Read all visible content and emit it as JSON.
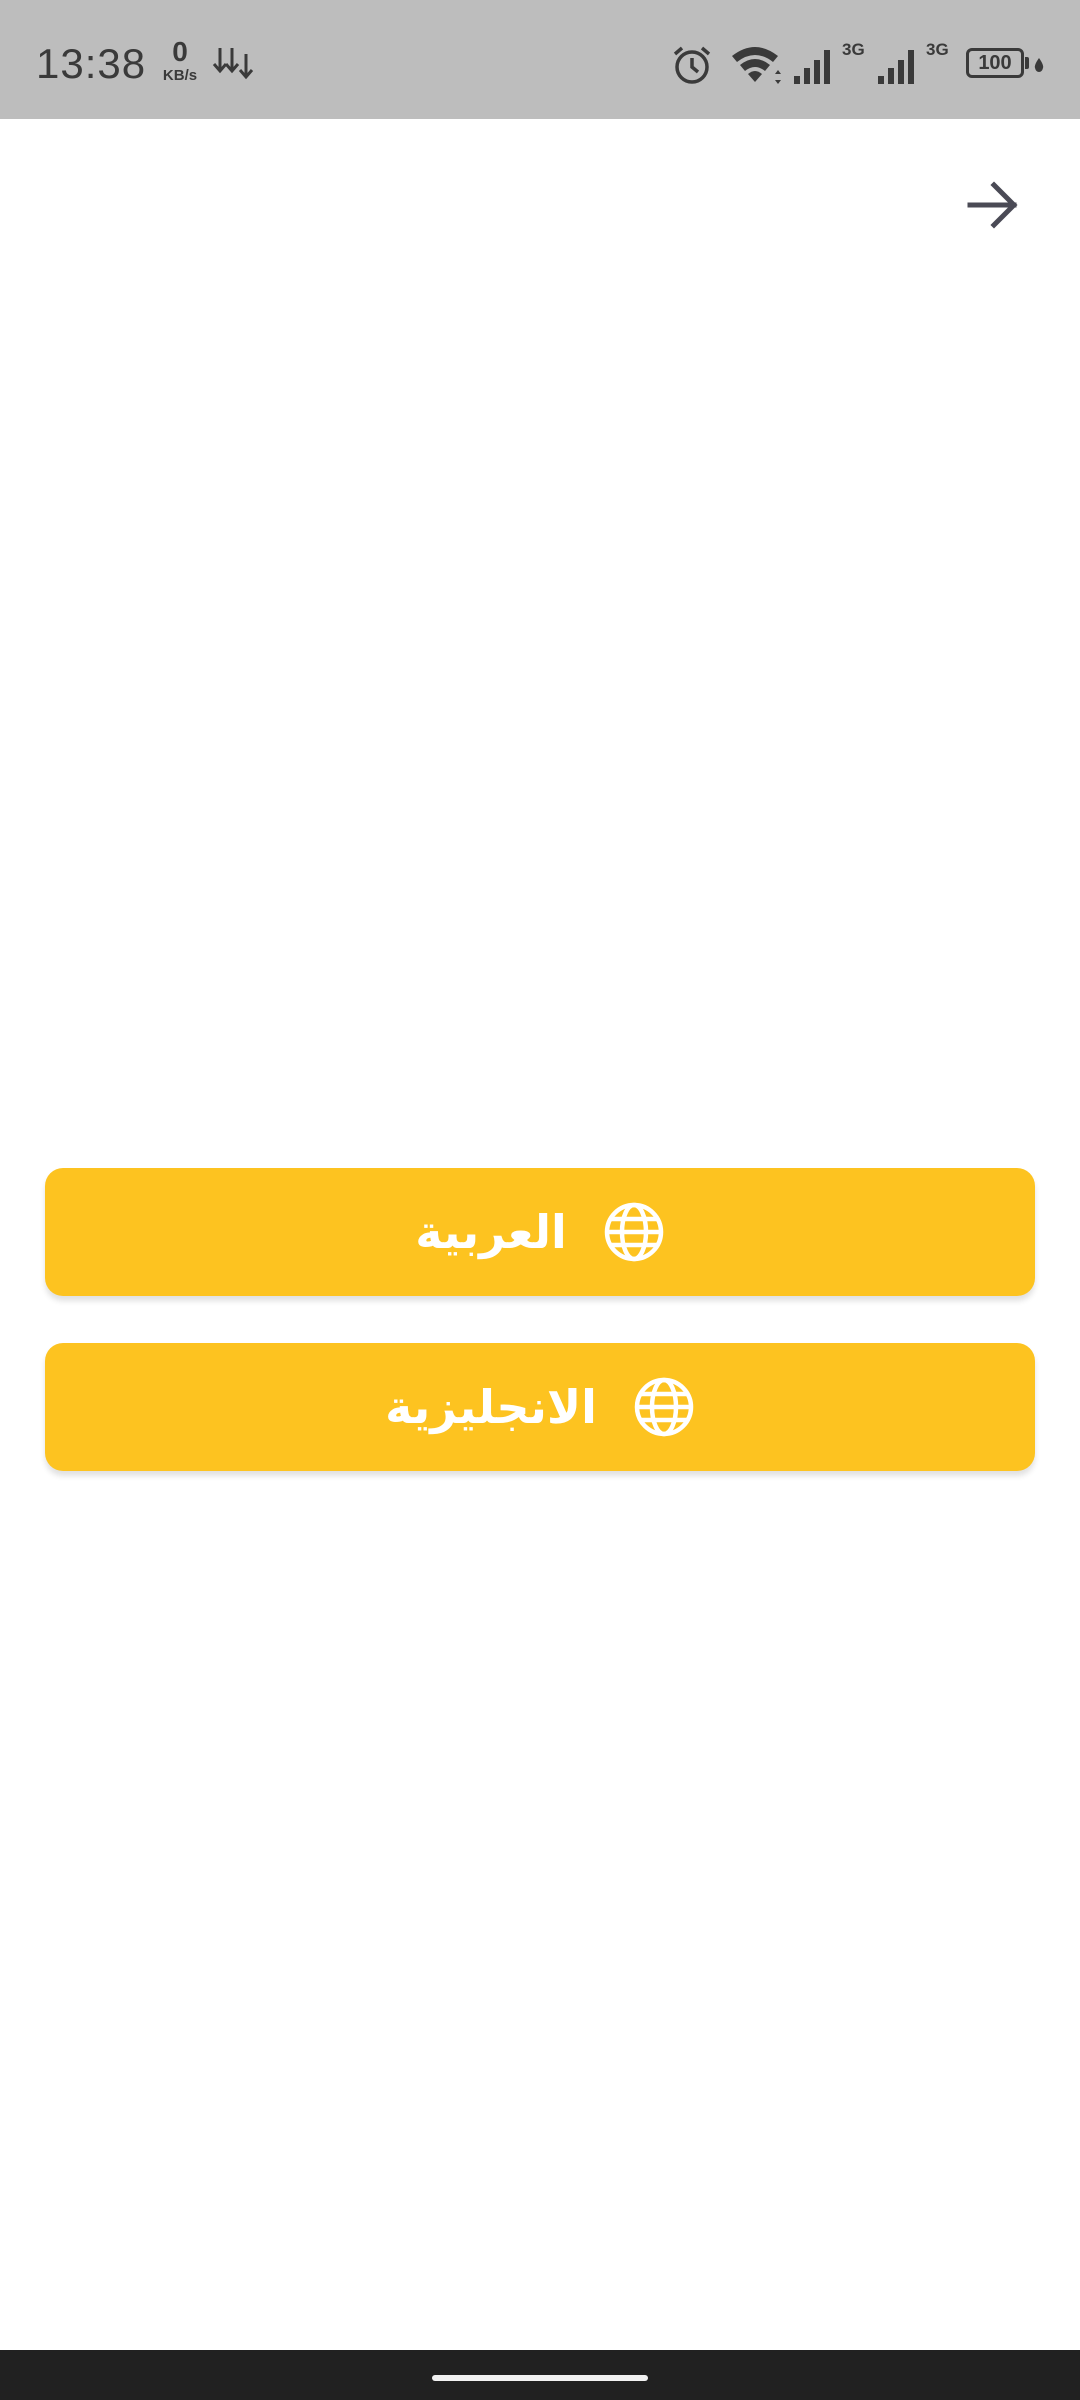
{
  "status_bar": {
    "time": "13:38",
    "net_speed_value": "0",
    "net_speed_unit": "KB/s",
    "signal_1_type": "3G",
    "signal_2_type": "3G",
    "battery_level": "100",
    "icons": [
      "data-arrows-icon",
      "alarm-icon",
      "wifi-icon",
      "signal-icon",
      "signal-icon",
      "battery-icon",
      "charging-icon"
    ]
  },
  "header": {
    "back_icon": "arrow-right-icon"
  },
  "language_options": [
    {
      "label": "العربية",
      "icon": "globe-icon"
    },
    {
      "label": "الانجليزية",
      "icon": "globe-icon"
    }
  ],
  "colors": {
    "status_bar_bg": "#bdbdbd",
    "button_bg": "#fdc320",
    "button_text": "#ffffff",
    "nav_bar_bg": "#212121"
  }
}
